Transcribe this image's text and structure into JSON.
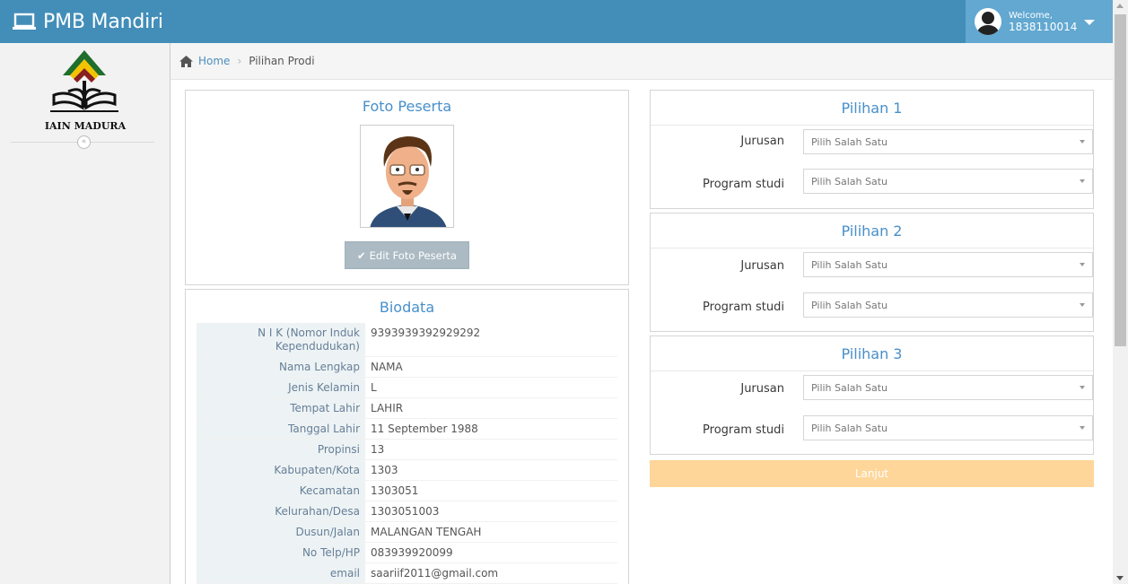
{
  "navbar": {
    "brand": "PMB Mandiri",
    "welcome_label": "Welcome,",
    "username": "1838110014"
  },
  "sidebar": {
    "logo_text": "IAIN MADURA",
    "collapse_symbol": "«"
  },
  "breadcrumb": {
    "home": "Home",
    "separator": "›",
    "current": "Pilihan Prodi"
  },
  "photo_panel": {
    "title": "Foto Peserta",
    "edit_button": "Edit Foto Peserta"
  },
  "biodata": {
    "title": "Biodata",
    "rows": [
      {
        "label": "N I K (Nomor Induk Kependudukan)",
        "value": "9393939392929292"
      },
      {
        "label": "Nama Lengkap",
        "value": "NAMA"
      },
      {
        "label": "Jenis Kelamin",
        "value": "L"
      },
      {
        "label": "Tempat Lahir",
        "value": "LAHIR"
      },
      {
        "label": "Tanggal Lahir",
        "value": "11 September 1988"
      },
      {
        "label": "Propinsi",
        "value": "13"
      },
      {
        "label": "Kabupaten/Kota",
        "value": "1303"
      },
      {
        "label": "Kecamatan",
        "value": "1303051"
      },
      {
        "label": "Kelurahan/Desa",
        "value": "1303051003"
      },
      {
        "label": "Dusun/Jalan",
        "value": "MALANGAN TENGAH"
      },
      {
        "label": "No Telp/HP",
        "value": "083939920099"
      },
      {
        "label": "email",
        "value": "saariif2011@gmail.com"
      }
    ]
  },
  "pilihan": [
    {
      "title": "Pilihan 1",
      "jurusan_label": "Jurusan",
      "jurusan_value": "Pilih Salah Satu",
      "prodi_label": "Program studi",
      "prodi_value": "Pilih Salah Satu"
    },
    {
      "title": "Pilihan 2",
      "jurusan_label": "Jurusan",
      "jurusan_value": "Pilih Salah Satu",
      "prodi_label": "Program studi",
      "prodi_value": "Pilih Salah Satu"
    },
    {
      "title": "Pilihan 3",
      "jurusan_label": "Jurusan",
      "jurusan_value": "Pilih Salah Satu",
      "prodi_label": "Program studi",
      "prodi_value": "Pilih Salah Satu"
    }
  ],
  "lanjut_button": "Lanjut",
  "colors": {
    "navbar": "#438eb9",
    "user_box": "#62a8d1",
    "title_blue": "#478fca",
    "lanjut": "#ffd699",
    "edit_button": "#abbac3"
  },
  "icons": {
    "brand": "laptop-icon",
    "user": "user-avatar-icon",
    "home": "home-icon",
    "edit": "check-icon"
  }
}
